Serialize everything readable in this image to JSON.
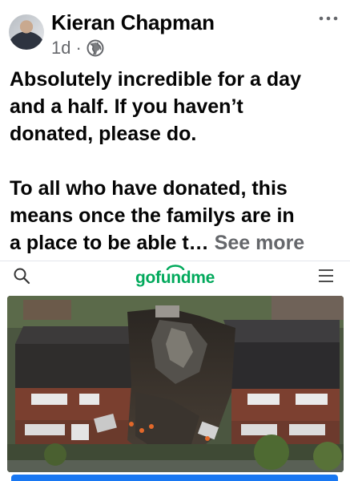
{
  "post": {
    "author": "Kieran Chapman",
    "time": "1d",
    "separator": "·",
    "privacy_icon": "globe-icon",
    "more_icon": "ellipsis-icon",
    "text_line_1": "Absolutely incredible for a day",
    "text_line_2": "and a half. If you haven’t",
    "text_line_3": "donated, please do.",
    "text_line_4": "To all who have donated, this",
    "text_line_5": "means once the familys are in",
    "text_line_6": "a place to be able t…",
    "see_more": "See more"
  },
  "link_preview": {
    "search_icon": "search-icon",
    "logo": "gofundme",
    "menu_icon": "hamburger-menu-icon",
    "image": "aerial-photo-destroyed-houses"
  },
  "colors": {
    "text": "#050505",
    "secondary": "#65676b",
    "gofundme_green": "#02a95c",
    "accent_blue": "#1877f2"
  }
}
